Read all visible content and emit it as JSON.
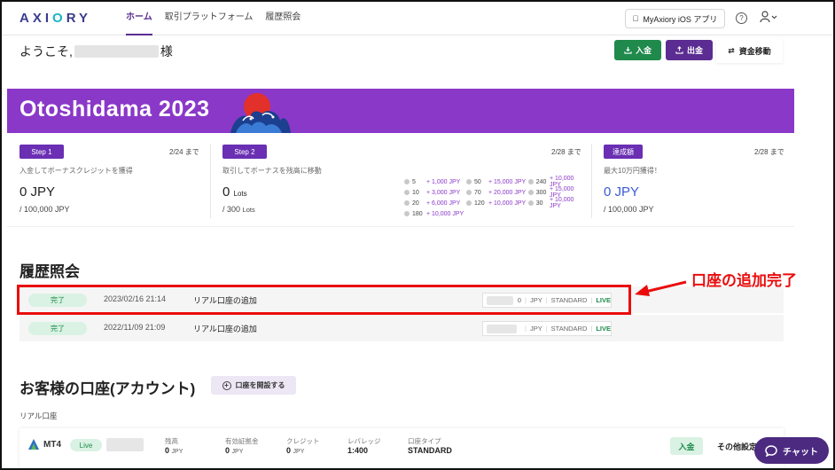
{
  "header": {
    "logo": "AXIORY",
    "nav": [
      "ホーム",
      "取引プラットフォーム",
      "履歴照会"
    ],
    "ios_button": "MyAxiory iOS アプリ",
    "help_icon": "question-circle-icon",
    "user_icon": "user-icon"
  },
  "welcome": {
    "prefix": "ようこそ,",
    "suffix": "様"
  },
  "actions": {
    "deposit": "入金",
    "withdraw": "出金",
    "transfer": "資金移動"
  },
  "banner": {
    "title": "Otoshidama 2023"
  },
  "steps": {
    "step1": {
      "badge": "Step 1",
      "date": "2/24 まで",
      "desc": "入金してボーナスクレジットを獲得",
      "value": "0 JPY",
      "sub": "/ 100,000 JPY"
    },
    "step2": {
      "badge": "Step 2",
      "date": "2/28 まで",
      "desc": "取引してボーナスを残高に移動",
      "value": "0",
      "value_unit": "Lots",
      "sub": "/ 300",
      "sub_unit": "Lots",
      "lots": [
        {
          "n": "5",
          "bonus": "+ 1,000 JPY"
        },
        {
          "n": "50",
          "bonus": "+ 15,000 JPY"
        },
        {
          "n": "240",
          "bonus": "+ 10,000 JPY"
        },
        {
          "n": "10",
          "bonus": "+ 3,000 JPY"
        },
        {
          "n": "70",
          "bonus": "+ 20,000 JPY"
        },
        {
          "n": "300",
          "bonus": "+ 15,000 JPY"
        },
        {
          "n": "20",
          "bonus": "+ 6,000 JPY"
        },
        {
          "n": "120",
          "bonus": "+ 10,000 JPY"
        },
        {
          "n": "30",
          "bonus": "+ 10,000 JPY"
        },
        {
          "n": "180",
          "bonus": "+ 10,000 JPY"
        }
      ]
    },
    "step3": {
      "badge": "達成額",
      "date": "2/28 まで",
      "desc": "最大10万円獲得！",
      "value": "0 JPY",
      "sub": "/ 100,000 JPY"
    }
  },
  "history": {
    "title": "履歴照会",
    "rows": [
      {
        "status": "完了",
        "date": "2023/02/16 21:14",
        "text": "リアル口座の追加",
        "acct_suffix": "0",
        "currency": "JPY",
        "type": "STANDARD",
        "live": "LIVE"
      },
      {
        "status": "完了",
        "date": "2022/11/09 21:09",
        "text": "リアル口座の追加",
        "acct_suffix": "",
        "currency": "JPY",
        "type": "STANDARD",
        "live": "LIVE"
      }
    ],
    "callout": "口座の追加完了"
  },
  "accounts": {
    "title": "お客様の口座(アカウント)",
    "open_button": "口座を開設する",
    "real_label": "リアル口座",
    "card": {
      "platform": "MT4",
      "live": "Live",
      "cols": [
        {
          "label": "残高",
          "value": "0",
          "unit": "JPY"
        },
        {
          "label": "有効証拠金",
          "value": "0",
          "unit": "JPY"
        },
        {
          "label": "クレジット",
          "value": "0",
          "unit": "JPY"
        },
        {
          "label": "レバレッジ",
          "value": "1:400",
          "unit": ""
        },
        {
          "label": "口座タイプ",
          "value": "STANDARD",
          "unit": ""
        }
      ],
      "deposit": "入金",
      "other": "その他設定"
    }
  },
  "chat": {
    "label": "チャット"
  },
  "colors": {
    "brand": "#5b2c91",
    "green": "#1f8a4c",
    "banner": "#8a38c8",
    "highlight": "#ea0c0c"
  }
}
